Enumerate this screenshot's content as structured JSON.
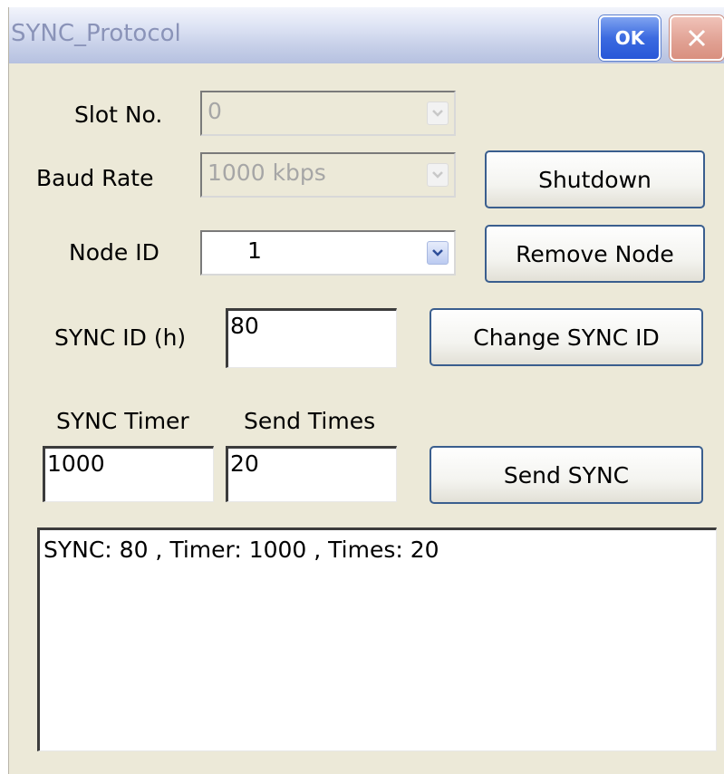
{
  "window": {
    "title": "SYNC_Protocol",
    "ok_label": "OK",
    "close_icon": "close-icon"
  },
  "slot": {
    "label": "Slot No.",
    "value": "0",
    "enabled": false
  },
  "baud": {
    "label": "Baud Rate",
    "value": "1000 kbps",
    "enabled": false
  },
  "node": {
    "label": "Node ID",
    "value": "1",
    "enabled": true
  },
  "sync_id": {
    "label": "SYNC ID (h)",
    "value": "80"
  },
  "sync_timer": {
    "label": "SYNC Timer",
    "value": "1000"
  },
  "send_times": {
    "label": "Send Times",
    "value": "20"
  },
  "buttons": {
    "shutdown": "Shutdown",
    "remove_node": "Remove Node",
    "change_sync_id": "Change SYNC ID",
    "send_sync": "Send SYNC"
  },
  "log": {
    "lines": [
      "SYNC: 80 , Timer: 1000 , Times: 20"
    ]
  },
  "colors": {
    "title_text": "#8a93b8",
    "ok_button": "#3b6ae0",
    "close_button": "#e0a092",
    "window_bg": "#ece9d8",
    "button_border": "#3a5e8e"
  }
}
